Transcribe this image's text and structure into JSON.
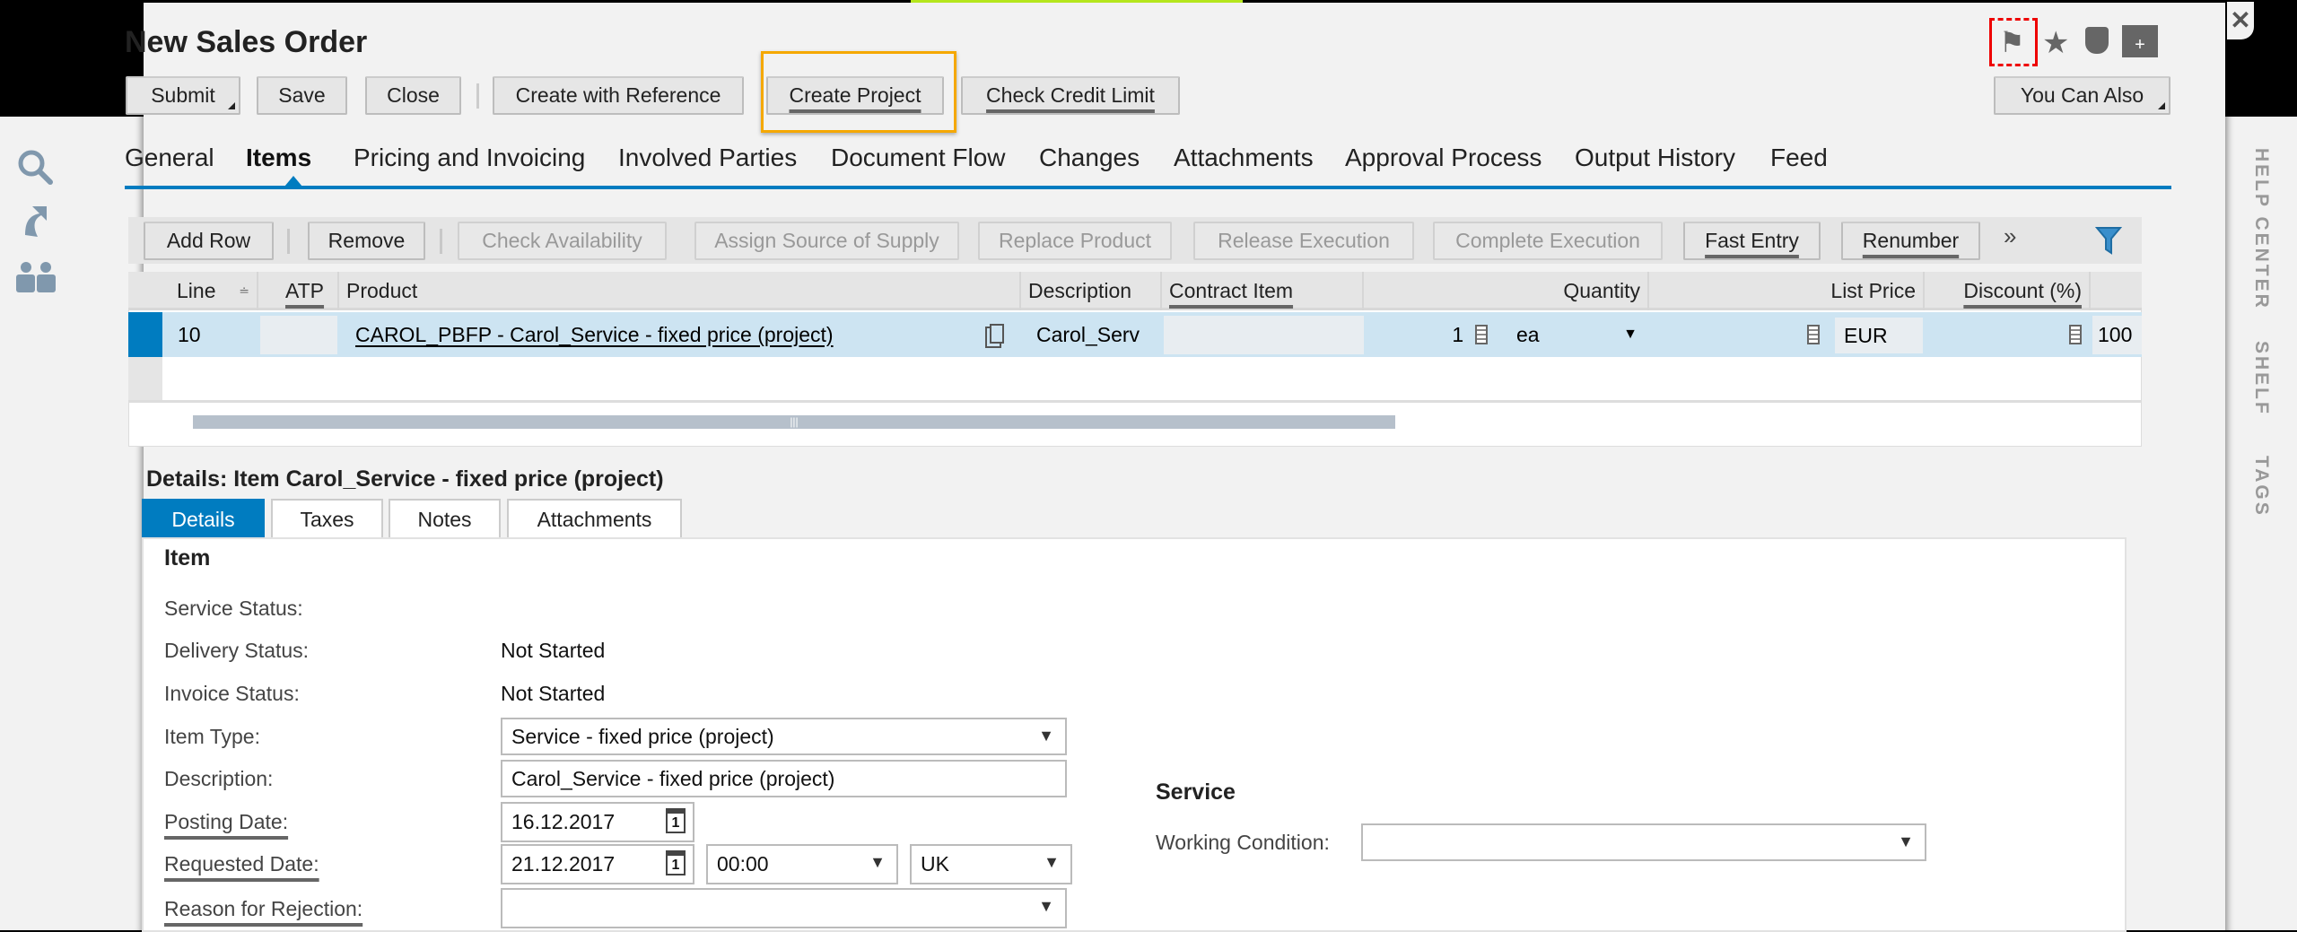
{
  "window": {
    "title": "New Sales Order",
    "close_icon": "close-icon"
  },
  "header_icons": [
    "flag-icon",
    "star-icon",
    "tag-icon",
    "add-document-icon"
  ],
  "toolbar": {
    "submit": "Submit",
    "save": "Save",
    "close": "Close",
    "create_with_reference": "Create with Reference",
    "create_project": "Create Project",
    "check_credit_limit": "Check Credit Limit",
    "you_can_also": "You Can Also"
  },
  "tabs": [
    "General",
    "Items",
    "Pricing and Invoicing",
    "Involved Parties",
    "Document Flow",
    "Changes",
    "Attachments",
    "Approval Process",
    "Output History",
    "Feed"
  ],
  "active_tab": "Items",
  "left_sidebar": [
    "search-icon",
    "share-arrow-icon",
    "people-icon"
  ],
  "right_sidebar": {
    "help_center": "HELP CENTER",
    "shelf": "SHELF",
    "tags": "TAGS"
  },
  "items_toolbar": {
    "add_row": "Add Row",
    "remove": "Remove",
    "check_availability": "Check Availability",
    "assign_source": "Assign Source of Supply",
    "replace_product": "Replace Product",
    "release_execution": "Release Execution",
    "complete_execution": "Complete Execution",
    "fast_entry": "Fast Entry",
    "renumber": "Renumber",
    "more": "»"
  },
  "table": {
    "columns": [
      "Line",
      "ATP",
      "Product",
      "Description",
      "Contract Item",
      "Quantity",
      "List Price",
      "Discount (%)"
    ],
    "rows": [
      {
        "line": "10",
        "atp": "",
        "product": "CAROL_PBFP - Carol_Service - fixed price (project)",
        "description": "Carol_Serv",
        "contract_item": "",
        "quantity": "1",
        "unit": "ea",
        "list_price": "",
        "currency": "EUR",
        "discount": "",
        "next": "100"
      }
    ]
  },
  "details": {
    "title": "Details: Item Carol_Service - fixed price (project)",
    "tabs": [
      "Details",
      "Taxes",
      "Notes",
      "Attachments"
    ],
    "item_heading": "Item",
    "service_status_label": "Service Status:",
    "delivery_status_label": "Delivery Status:",
    "delivery_status": "Not Started",
    "invoice_status_label": "Invoice Status:",
    "invoice_status": "Not Started",
    "item_type_label": "Item Type:",
    "item_type": "Service - fixed price (project)",
    "description_label": "Description:",
    "description": "Carol_Service - fixed price (project)",
    "posting_date_label": "Posting Date:",
    "posting_date": "16.12.2017",
    "requested_date_label": "Requested Date:",
    "requested_date": "21.12.2017",
    "requested_time": "00:00",
    "timezone": "UK",
    "reason_label": "Reason for Rejection:",
    "reason": "",
    "service_heading": "Service",
    "working_condition_label": "Working Condition:",
    "working_condition": ""
  },
  "colors": {
    "accent": "#007cc0",
    "selected_row": "#cde4f2",
    "highlight": "#f5a800"
  }
}
